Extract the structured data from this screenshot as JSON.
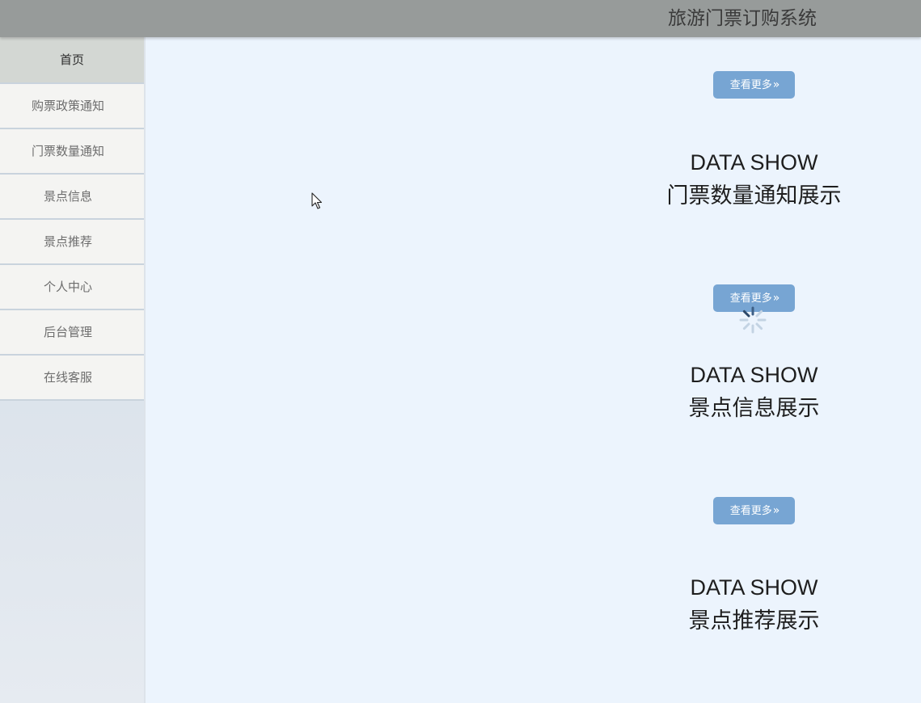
{
  "header": {
    "title": "旅游门票订购系统"
  },
  "sidebar": {
    "items": [
      {
        "label": "首页",
        "active": true
      },
      {
        "label": "购票政策通知",
        "active": false
      },
      {
        "label": "门票数量通知",
        "active": false
      },
      {
        "label": "景点信息",
        "active": false
      },
      {
        "label": "景点推荐",
        "active": false
      },
      {
        "label": "个人中心",
        "active": false
      },
      {
        "label": "后台管理",
        "active": false
      },
      {
        "label": "在线客服",
        "active": false
      }
    ]
  },
  "main": {
    "sections": [
      {
        "more_label": "查看更多",
        "more_icon": "double-chevron-right",
        "heading": "DATA SHOW",
        "subheading": "门票数量通知展示"
      },
      {
        "more_label": "查看更多",
        "more_icon": "double-chevron-right",
        "heading": "DATA SHOW",
        "subheading": "景点信息展示"
      },
      {
        "more_label": "查看更多",
        "more_icon": "double-chevron-right",
        "heading": "DATA SHOW",
        "subheading": "景点推荐展示"
      }
    ],
    "loading_icon": "loading-spinner"
  },
  "colors": {
    "header_bg": "#979b9a",
    "sidebar_item_bg": "#f4f4f2",
    "sidebar_active_bg": "#d3d7d3",
    "main_bg": "#ecf4fd",
    "button_bg": "#77a5d3"
  }
}
